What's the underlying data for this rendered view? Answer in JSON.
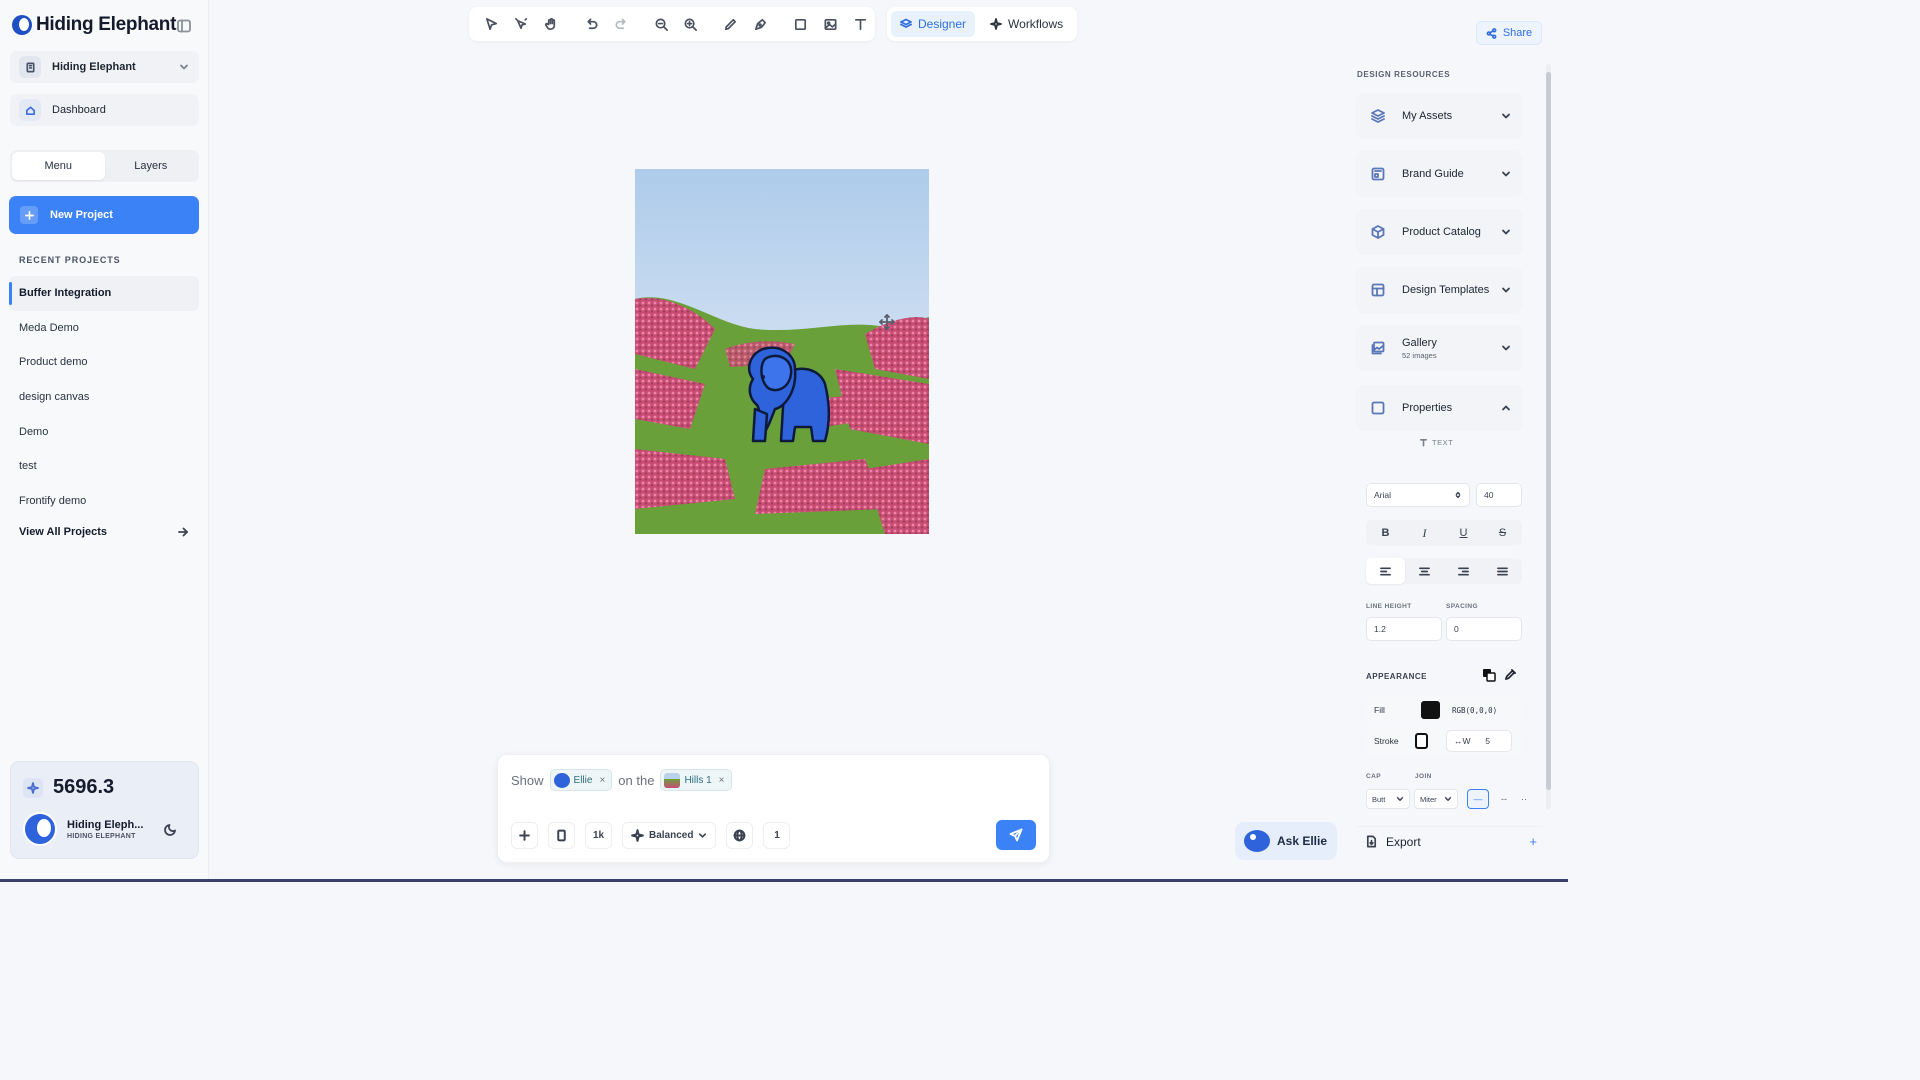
{
  "brand": {
    "name": "Hiding Elephant"
  },
  "workspace": {
    "name": "Hiding Elephant"
  },
  "nav": {
    "dashboard": "Dashboard"
  },
  "tabs": {
    "menu": "Menu",
    "layers": "Layers"
  },
  "new_project": "New Project",
  "recent": {
    "heading": "RECENT PROJECTS",
    "items": [
      "Buffer Integration",
      "Meda Demo",
      "Product demo",
      "design canvas",
      "Demo",
      "test",
      "Frontify demo"
    ],
    "view_all": "View All Projects"
  },
  "credits": {
    "value": "5696.3"
  },
  "user": {
    "name": "Hiding Eleph...",
    "org": "HIDING ELEPHANT"
  },
  "modes": {
    "designer": "Designer",
    "workflows": "Workflows"
  },
  "prompt": {
    "word_show": "Show",
    "chip_ellie": "Ellie",
    "word_on_the": "on the",
    "chip_hills": "Hills 1",
    "resolution": "1k",
    "quality": "Balanced",
    "count": "1"
  },
  "share": "Share",
  "resources": {
    "heading": "DESIGN RESOURCES",
    "my_assets": "My Assets",
    "brand_guide": "Brand Guide",
    "product_catalog": "Product Catalog",
    "design_templates": "Design Templates",
    "gallery": "Gallery",
    "gallery_count": "52 images",
    "properties": "Properties"
  },
  "properties": {
    "type_label": "TEXT",
    "font": "Arial",
    "size": "40",
    "line_height_label": "LINE HEIGHT",
    "spacing_label": "SPACING",
    "line_height": "1.2",
    "spacing": "0",
    "appearance_label": "APPEARANCE",
    "fill_label": "Fill",
    "fill_value": "RGB(0,0,0)",
    "stroke_label": "Stroke",
    "stroke_w_label": "↔W",
    "stroke_w": "5",
    "cap_label": "CAP",
    "join_label": "JOIN",
    "cap": "Butt",
    "join": "Miter"
  },
  "ask_ellie": "Ask Ellie",
  "export": "Export",
  "colors": {
    "accent": "#3b82f6",
    "elephant": "#2f63dc",
    "flowers": "#d9577e",
    "grass": "#6aa03a",
    "sky": "#b9d3ec"
  }
}
